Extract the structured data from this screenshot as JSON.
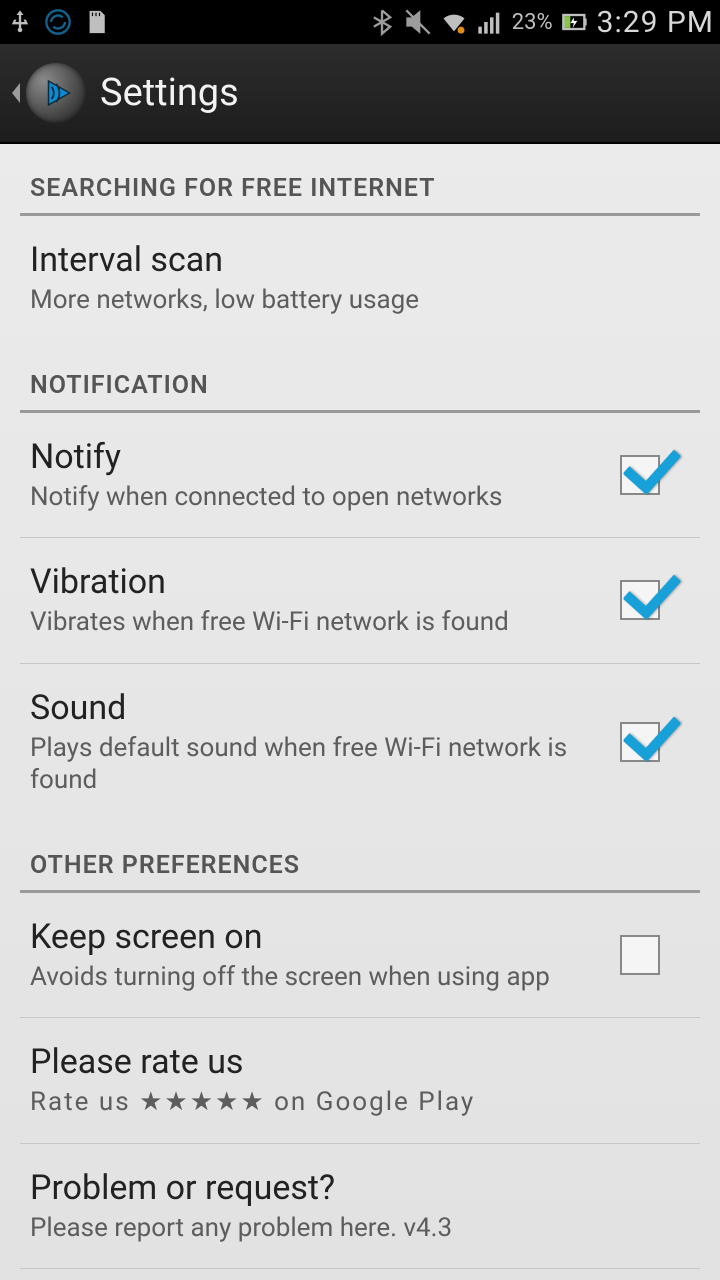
{
  "status": {
    "battery_pct": "23%",
    "time": "3:29 PM"
  },
  "actionbar": {
    "title": "Settings"
  },
  "sections": {
    "search": {
      "header": "SEARCHING FOR FREE INTERNET"
    },
    "notification": {
      "header": "NOTIFICATION"
    },
    "other": {
      "header": "OTHER PREFERENCES"
    }
  },
  "items": {
    "interval": {
      "title": "Interval scan",
      "sub": "More networks, low battery usage"
    },
    "notify": {
      "title": "Notify",
      "sub": "Notify when connected to open networks",
      "checked": true
    },
    "vibration": {
      "title": "Vibration",
      "sub": "Vibrates when free Wi-Fi network is found",
      "checked": true
    },
    "sound": {
      "title": "Sound",
      "sub": "Plays default sound when free Wi-Fi network is found",
      "checked": true
    },
    "keepscreen": {
      "title": "Keep screen on",
      "sub": "Avoids turning off the screen when using app",
      "checked": false
    },
    "rate": {
      "title": "Please rate us",
      "sub": "Rate us ★★★★★ on Google Play"
    },
    "problem": {
      "title": "Problem or request?",
      "sub": "Please report any problem here. v4.3"
    }
  }
}
